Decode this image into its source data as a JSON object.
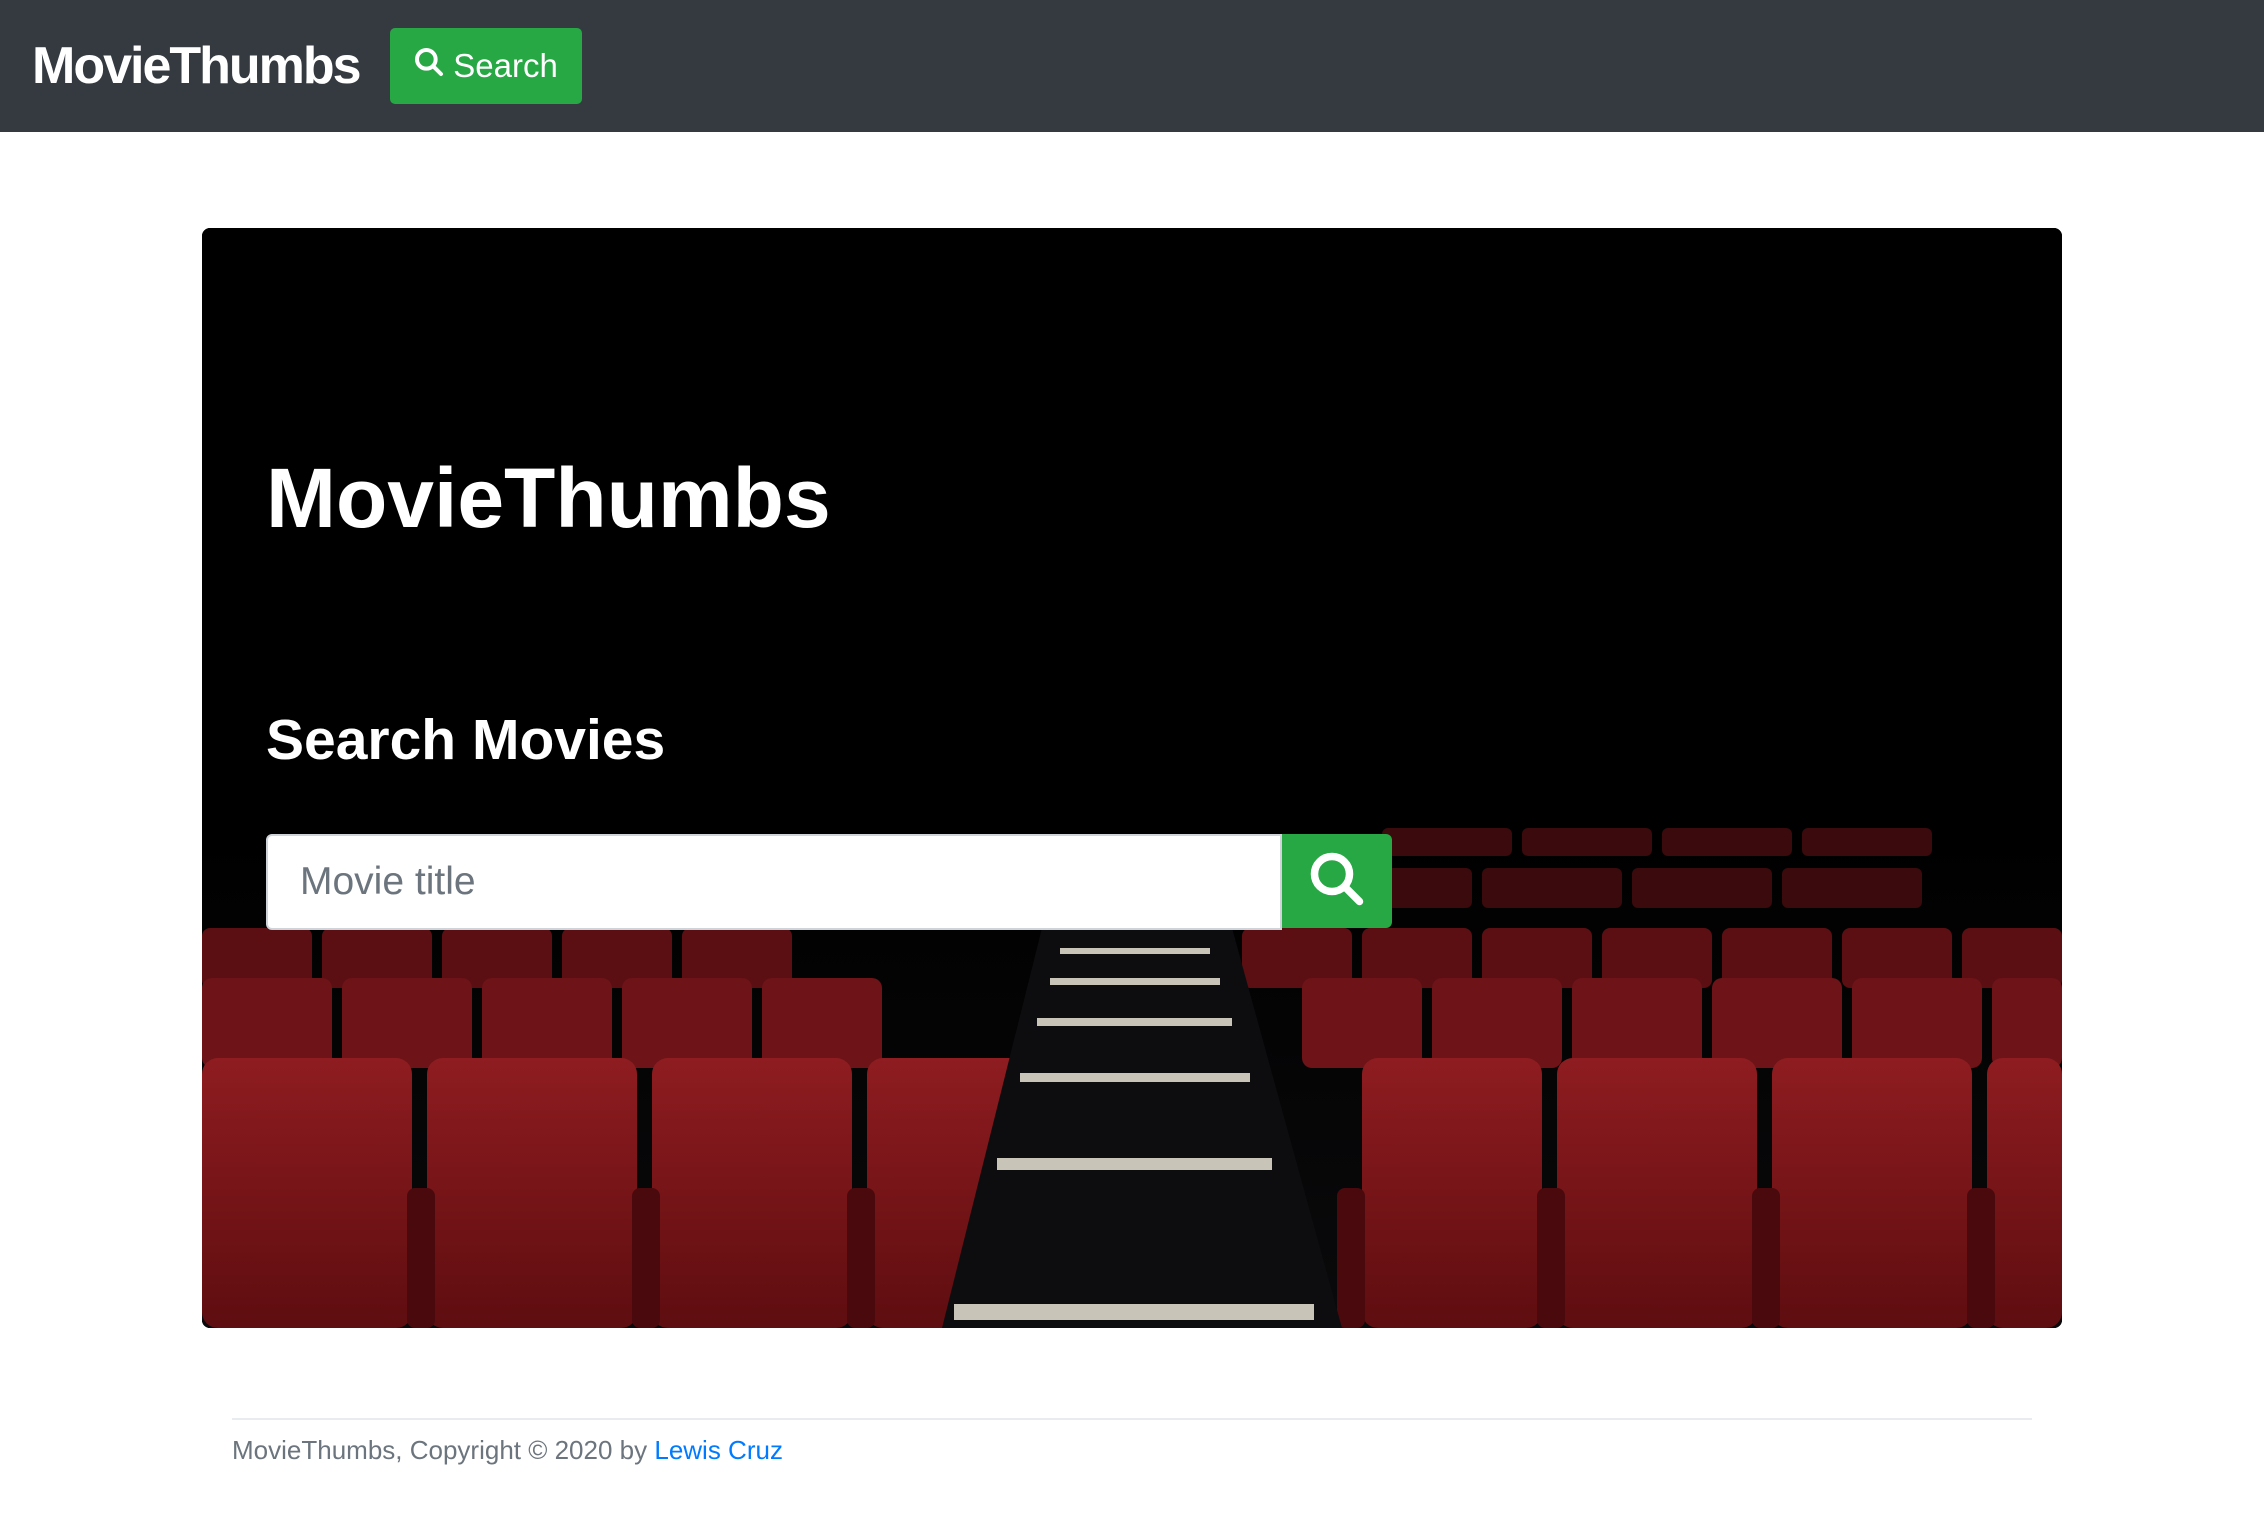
{
  "navbar": {
    "brand": "MovieThumbs",
    "search_button_label": "Search",
    "search_icon": "search-icon"
  },
  "hero": {
    "title": "MovieThumbs",
    "subtitle": "Search Movies",
    "search_placeholder": "Movie title",
    "search_value": "",
    "submit_icon": "search-icon"
  },
  "footer": {
    "text": "MovieThumbs, Copyright © 2020 by ",
    "author_link": "Lewis Cruz"
  },
  "colors": {
    "navbar": "#343a40",
    "accent_green": "#28a745",
    "link_blue": "#007bff",
    "seat_red": "#7d1418"
  }
}
